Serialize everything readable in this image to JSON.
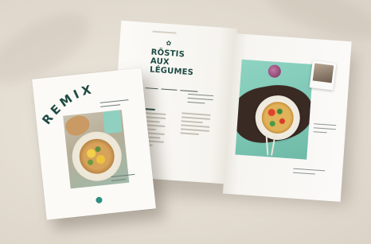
{
  "cover": {
    "title": "REMIX"
  },
  "spread": {
    "recipe_title_line1": "RÖSTIS",
    "recipe_title_line2": "AUX LÉGUMES"
  },
  "colors": {
    "background": "#e3dcd1",
    "title_ink": "#1f4a44",
    "photo_mint": "#7cc6b4"
  }
}
